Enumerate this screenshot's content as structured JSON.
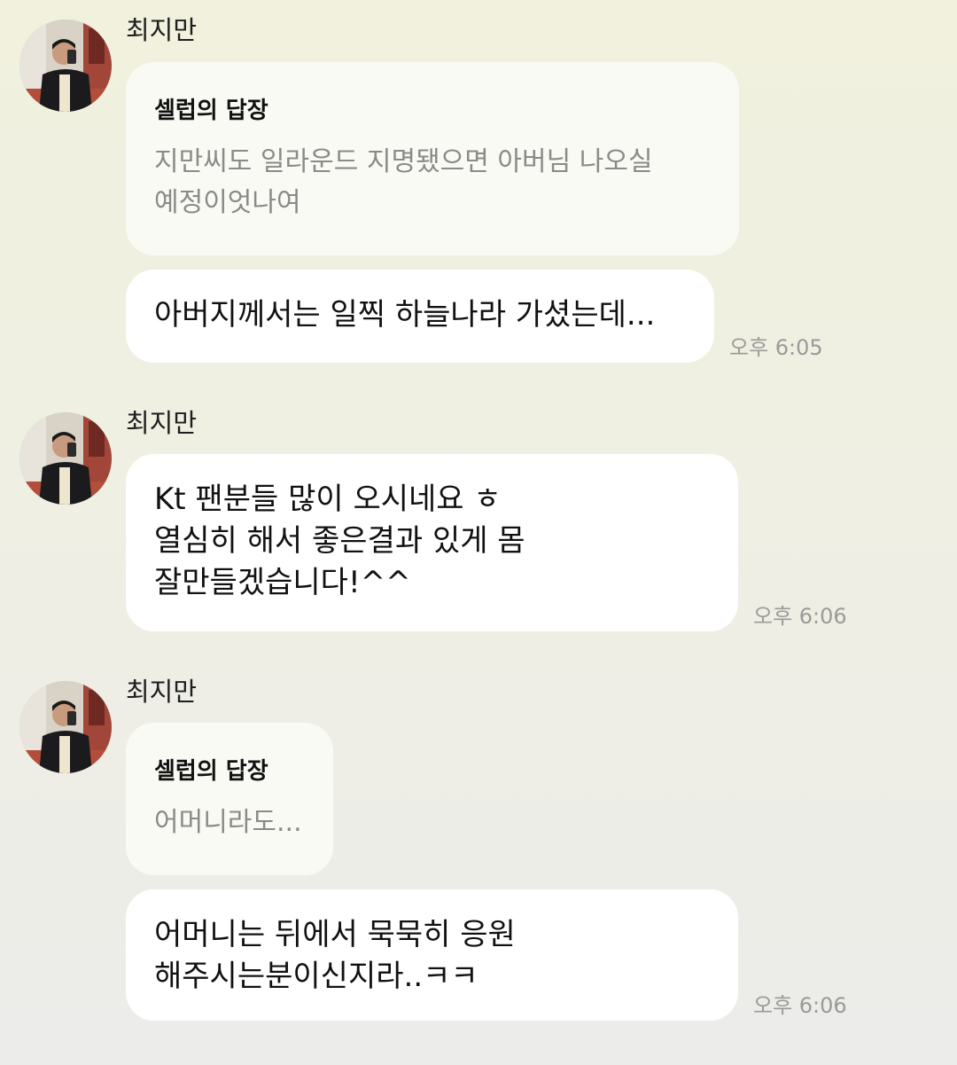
{
  "messages": [
    {
      "sender": "최지만",
      "avatar_icon": "profile-photo",
      "reply": {
        "title": "셀럽의 답장",
        "body": "지만씨도 일라운드 지명됐으면 아버님 나오실\n예정이엇나여"
      },
      "text": "아버지께서는 일찍 하늘나라 가셨는데...",
      "time": "오후 6:05"
    },
    {
      "sender": "최지만",
      "avatar_icon": "profile-photo",
      "text": "Kt 팬분들 많이 오시네요 ㅎ\n열심히 해서 좋은결과 있게 몸\n잘만들겠습니다!^^",
      "time": "오후 6:06"
    },
    {
      "sender": "최지만",
      "avatar_icon": "profile-photo",
      "reply": {
        "title": "셀럽의 답장",
        "body": "어머니라도..."
      },
      "text": "어머니는 뒤에서 묵묵히 응원\n해주시는분이신지라..ㅋㅋ",
      "time": "오후 6:06"
    }
  ],
  "colors": {
    "background_top": "#f1f1de",
    "bubble": "#ffffff",
    "reply_bubble": "#fafaf4",
    "reply_text": "#8a8a8a",
    "time_text": "#9a9a9a"
  }
}
